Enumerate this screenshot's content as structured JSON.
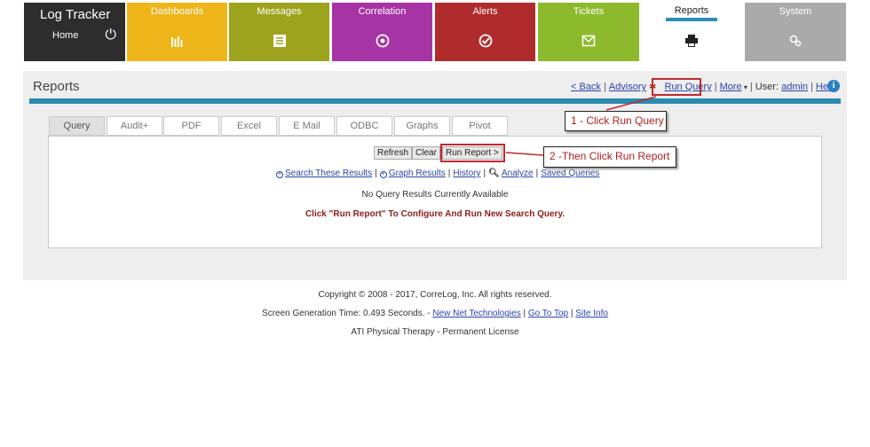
{
  "app": {
    "brand": "Log Tracker",
    "home_label": "Home"
  },
  "tiles": [
    {
      "id": "dashboards",
      "label": "Dashboards",
      "icon": "bar-chart-icon",
      "color": "#eeb51a"
    },
    {
      "id": "messages",
      "label": "Messages",
      "icon": "message-list-icon",
      "color": "#9ea31e"
    },
    {
      "id": "correlation",
      "label": "Correlation",
      "icon": "correlation-icon",
      "color": "#a734a5"
    },
    {
      "id": "alerts",
      "label": "Alerts",
      "icon": "check-circle-icon",
      "color": "#b02c2c"
    },
    {
      "id": "tickets",
      "label": "Tickets",
      "icon": "envelope-icon",
      "color": "#8dba2c"
    },
    {
      "id": "reports",
      "label": "Reports",
      "icon": "printer-icon",
      "color": "#ffffff",
      "active": true
    },
    {
      "id": "system",
      "label": "System",
      "icon": "gears-icon",
      "color": "#aaaaaa"
    }
  ],
  "page": {
    "title": "Reports"
  },
  "topnav": {
    "back": "< Back",
    "advisory": "Advisory",
    "run_query": "Run Query",
    "more": "More",
    "user_label": "User:",
    "user": "admin",
    "help": "Help"
  },
  "tabs": [
    "Query",
    "Audit+",
    "PDF",
    "Excel",
    "E Mail",
    "ODBC",
    "Graphs",
    "Pivot"
  ],
  "buttons": {
    "refresh": "Refresh",
    "clear": "Clear",
    "run_report": "Run Report >"
  },
  "actions": {
    "search_results": "Search These Results",
    "graph_results": "Graph Results",
    "history": "History",
    "analyze": "Analyze",
    "saved_queries": "Saved Queries"
  },
  "messages": {
    "no_results": "No Query Results Currently Available",
    "run_hint": "Click \"Run Report\" To Configure And Run New Search Query."
  },
  "annotations": {
    "step1": "1 - Click Run Query",
    "step2": "2 -Then Click Run Report"
  },
  "footer": {
    "copyright": "Copyright © 2008 - 2017, CorreLog, Inc. All rights reserved.",
    "generation": "Screen Generation Time: 0.493 Seconds. -",
    "nnt": "New Net Technologies",
    "go_top": "Go To Top",
    "site_info": "Site Info",
    "license": "ATI Physical Therapy - Permanent License"
  },
  "colors": {
    "accent_bar": "#2a8bb0",
    "annotation_red": "#c0292f",
    "link": "#2a45a8"
  }
}
